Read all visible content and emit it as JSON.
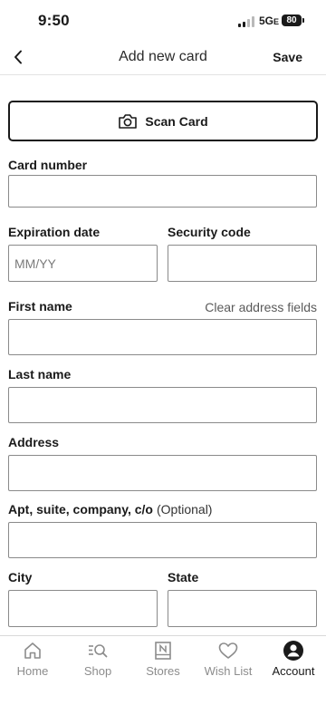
{
  "status_bar": {
    "time": "9:50",
    "network": "5G",
    "network_suffix": "E",
    "battery": "80"
  },
  "header": {
    "back_icon": "chevron-left-icon",
    "title": "Add new card",
    "save_label": "Save"
  },
  "scan_card": {
    "icon": "camera-icon",
    "label": "Scan Card"
  },
  "form": {
    "card_number": {
      "label": "Card number",
      "value": "",
      "placeholder": ""
    },
    "expiration_date": {
      "label": "Expiration date",
      "value": "",
      "placeholder": "MM/YY"
    },
    "security_code": {
      "label": "Security code",
      "value": "",
      "placeholder": ""
    },
    "first_name": {
      "label": "First name",
      "value": "",
      "placeholder": ""
    },
    "clear_address_label": "Clear address fields",
    "last_name": {
      "label": "Last name",
      "value": "",
      "placeholder": ""
    },
    "address": {
      "label": "Address",
      "value": "",
      "placeholder": ""
    },
    "apt": {
      "label": "Apt, suite, company, c/o",
      "optional": "(Optional)",
      "value": "",
      "placeholder": ""
    },
    "city": {
      "label": "City",
      "value": "",
      "placeholder": ""
    },
    "state": {
      "label": "State",
      "value": "",
      "placeholder": ""
    }
  },
  "bottom_nav": {
    "items": [
      {
        "label": "Home",
        "icon": "home-icon",
        "active": false
      },
      {
        "label": "Shop",
        "icon": "search-list-icon",
        "active": false
      },
      {
        "label": "Stores",
        "icon": "store-icon",
        "active": false
      },
      {
        "label": "Wish List",
        "icon": "heart-icon",
        "active": false
      },
      {
        "label": "Account",
        "icon": "account-icon",
        "active": true
      }
    ]
  },
  "colors": {
    "text": "#1a1a1a",
    "muted": "#8c8c8c",
    "border": "#8a8a8a",
    "link": "#5a5a5a"
  }
}
